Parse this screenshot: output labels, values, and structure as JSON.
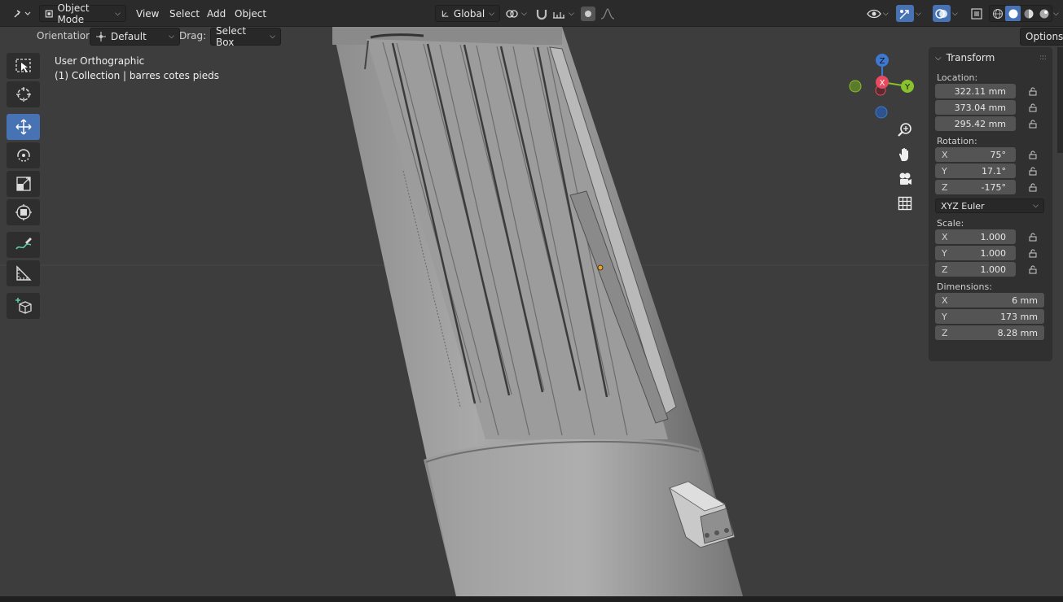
{
  "header": {
    "mode": "Object Mode",
    "menus": [
      "View",
      "Select",
      "Add",
      "Object"
    ],
    "transform_orientation": "Global",
    "options_label": "Options"
  },
  "tool_settings": {
    "orientation_label": "Orientation:",
    "orientation_value": "Default",
    "drag_label": "Drag:",
    "drag_value": "Select Box"
  },
  "viewport": {
    "view_name": "User Orthographic",
    "collection_info": "(1) Collection | barres cotes pieds",
    "axes": {
      "x": "X",
      "y": "Y",
      "z": "Z"
    }
  },
  "colors": {
    "accent": "#4772b3",
    "axis_x": "#e84a5f",
    "axis_y": "#8ac12c",
    "axis_z": "#3d79d0",
    "background": "#3d3d3d"
  },
  "transform_panel": {
    "title": "Transform",
    "location_label": "Location:",
    "location": [
      "322.11 mm",
      "373.04 mm",
      "295.42 mm"
    ],
    "rotation_label": "Rotation:",
    "rotation": [
      {
        "axis": "X",
        "value": "75°"
      },
      {
        "axis": "Y",
        "value": "17.1°"
      },
      {
        "axis": "Z",
        "value": "-175°"
      }
    ],
    "rotation_mode": "XYZ Euler",
    "scale_label": "Scale:",
    "scale": [
      {
        "axis": "X",
        "value": "1.000"
      },
      {
        "axis": "Y",
        "value": "1.000"
      },
      {
        "axis": "Z",
        "value": "1.000"
      }
    ],
    "dimensions_label": "Dimensions:",
    "dimensions": [
      {
        "axis": "X",
        "value": "6 mm"
      },
      {
        "axis": "Y",
        "value": "173 mm"
      },
      {
        "axis": "Z",
        "value": "8.28 mm"
      }
    ]
  }
}
